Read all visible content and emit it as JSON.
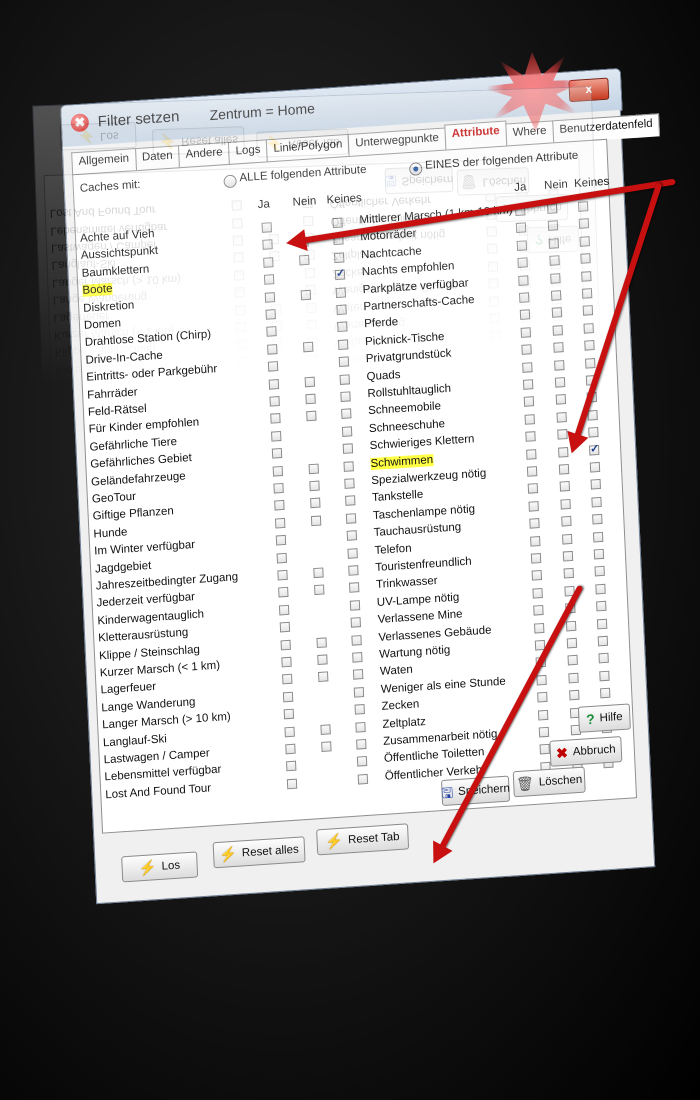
{
  "window": {
    "title": "Filter setzen",
    "subtitle": "Zentrum = Home",
    "close_label": "x"
  },
  "tabs": [
    {
      "label": "Allgemein"
    },
    {
      "label": "Daten"
    },
    {
      "label": "Andere"
    },
    {
      "label": "Logs"
    },
    {
      "label": "Linie/Polygon"
    },
    {
      "label": "Unterwegpunkte"
    },
    {
      "label": "Attribute",
      "active": true
    },
    {
      "label": "Where"
    },
    {
      "label": "Benutzerdatenfeld"
    }
  ],
  "caches_mit": {
    "label": "Caches mit:",
    "option_all": "ALLE folgenden Attribute",
    "option_any": "EINES der folgenden Attribute",
    "selected": "any"
  },
  "column_headers": {
    "ja": "Ja",
    "nein": "Nein",
    "keines": "Keines"
  },
  "left_attributes": [
    {
      "label": "Achte auf Vieh",
      "ja": false,
      "nein": null,
      "keines": false
    },
    {
      "label": "Aussichtspunkt",
      "ja": false,
      "nein": false,
      "keines": false
    },
    {
      "label": "Baumklettern",
      "ja": false,
      "nein": false,
      "keines": false
    },
    {
      "label": "Boote",
      "ja": false,
      "nein": null,
      "keines": true,
      "highlight": true
    },
    {
      "label": "Diskretion",
      "ja": false,
      "nein": false,
      "keines": false
    },
    {
      "label": "Domen",
      "ja": false,
      "nein": null,
      "keines": false
    },
    {
      "label": "Drahtlose Station (Chirp)",
      "ja": false,
      "nein": null,
      "keines": false
    },
    {
      "label": "Drive-In-Cache",
      "ja": false,
      "nein": false,
      "keines": false
    },
    {
      "label": "Eintritts- oder Parkgebühr",
      "ja": false,
      "nein": null,
      "keines": false
    },
    {
      "label": "Fahrräder",
      "ja": false,
      "nein": false,
      "keines": false
    },
    {
      "label": "Feld-Rätsel",
      "ja": false,
      "nein": false,
      "keines": false
    },
    {
      "label": "Für Kinder empfohlen",
      "ja": false,
      "nein": false,
      "keines": false
    },
    {
      "label": "Gefährliche Tiere",
      "ja": false,
      "nein": null,
      "keines": false
    },
    {
      "label": "Gefährliches Gebiet",
      "ja": false,
      "nein": null,
      "keines": false
    },
    {
      "label": "Geländefahrzeuge",
      "ja": false,
      "nein": false,
      "keines": false
    },
    {
      "label": "GeoTour",
      "ja": false,
      "nein": false,
      "keines": false
    },
    {
      "label": "Giftige Pflanzen",
      "ja": false,
      "nein": false,
      "keines": false
    },
    {
      "label": "Hunde",
      "ja": false,
      "nein": false,
      "keines": false
    },
    {
      "label": "Im Winter verfügbar",
      "ja": false,
      "nein": null,
      "keines": false
    },
    {
      "label": "Jagdgebiet",
      "ja": false,
      "nein": null,
      "keines": false
    },
    {
      "label": "Jahreszeitbedingter Zugang",
      "ja": false,
      "nein": false,
      "keines": false
    },
    {
      "label": "Jederzeit verfügbar",
      "ja": false,
      "nein": false,
      "keines": false
    },
    {
      "label": "Kinderwagentauglich",
      "ja": false,
      "nein": null,
      "keines": false
    },
    {
      "label": "Kletterausrüstung",
      "ja": false,
      "nein": null,
      "keines": false
    },
    {
      "label": "Klippe / Steinschlag",
      "ja": false,
      "nein": false,
      "keines": false
    },
    {
      "label": "Kurzer Marsch (< 1 km)",
      "ja": false,
      "nein": false,
      "keines": false
    },
    {
      "label": "Lagerfeuer",
      "ja": false,
      "nein": false,
      "keines": false
    },
    {
      "label": "Lange Wanderung",
      "ja": false,
      "nein": null,
      "keines": false
    },
    {
      "label": "Langer Marsch (> 10 km)",
      "ja": false,
      "nein": null,
      "keines": false
    },
    {
      "label": "Langlauf-Ski",
      "ja": false,
      "nein": false,
      "keines": false
    },
    {
      "label": "Lastwagen / Camper",
      "ja": false,
      "nein": false,
      "keines": false
    },
    {
      "label": "Lebensmittel verfügbar",
      "ja": false,
      "nein": null,
      "keines": false
    },
    {
      "label": "Lost And Found Tour",
      "ja": false,
      "nein": null,
      "keines": false
    }
  ],
  "right_attributes": [
    {
      "label": "Mittlerer Marsch (1 km-10 km)",
      "ja": false,
      "nein": false,
      "keines": false
    },
    {
      "label": "Motorräder",
      "ja": false,
      "nein": false,
      "keines": false
    },
    {
      "label": "Nachtcache",
      "ja": false,
      "nein": false,
      "keines": false
    },
    {
      "label": "Nachts empfohlen",
      "ja": false,
      "nein": false,
      "keines": false
    },
    {
      "label": "Parkplätze verfügbar",
      "ja": false,
      "nein": false,
      "keines": false
    },
    {
      "label": "Partnerschafts-Cache",
      "ja": false,
      "nein": false,
      "keines": false
    },
    {
      "label": "Pferde",
      "ja": false,
      "nein": false,
      "keines": false
    },
    {
      "label": "Picknick-Tische",
      "ja": false,
      "nein": false,
      "keines": false
    },
    {
      "label": "Privatgrundstück",
      "ja": false,
      "nein": false,
      "keines": false
    },
    {
      "label": "Quads",
      "ja": false,
      "nein": false,
      "keines": false
    },
    {
      "label": "Rollstuhltauglich",
      "ja": false,
      "nein": false,
      "keines": false
    },
    {
      "label": "Schneemobile",
      "ja": false,
      "nein": false,
      "keines": false
    },
    {
      "label": "Schneeschuhe",
      "ja": false,
      "nein": false,
      "keines": false
    },
    {
      "label": "Schwieriges Klettern",
      "ja": false,
      "nein": false,
      "keines": false
    },
    {
      "label": "Schwimmen",
      "ja": false,
      "nein": false,
      "keines": true,
      "highlight": true
    },
    {
      "label": "Spezialwerkzeug nötig",
      "ja": false,
      "nein": false,
      "keines": false
    },
    {
      "label": "Tankstelle",
      "ja": false,
      "nein": false,
      "keines": false
    },
    {
      "label": "Taschenlampe nötig",
      "ja": false,
      "nein": false,
      "keines": false
    },
    {
      "label": "Tauchausrüstung",
      "ja": false,
      "nein": false,
      "keines": false
    },
    {
      "label": "Telefon",
      "ja": false,
      "nein": false,
      "keines": false
    },
    {
      "label": "Touristenfreundlich",
      "ja": false,
      "nein": false,
      "keines": false
    },
    {
      "label": "Trinkwasser",
      "ja": false,
      "nein": false,
      "keines": false
    },
    {
      "label": "UV-Lampe nötig",
      "ja": false,
      "nein": false,
      "keines": false
    },
    {
      "label": "Verlassene Mine",
      "ja": false,
      "nein": false,
      "keines": false
    },
    {
      "label": "Verlassenes Gebäude",
      "ja": false,
      "nein": false,
      "keines": false
    },
    {
      "label": "Wartung nötig",
      "ja": false,
      "nein": false,
      "keines": false
    },
    {
      "label": "Waten",
      "ja": false,
      "nein": false,
      "keines": false
    },
    {
      "label": "Weniger als eine Stunde",
      "ja": false,
      "nein": false,
      "keines": false
    },
    {
      "label": "Zecken",
      "ja": false,
      "nein": false,
      "keines": false
    },
    {
      "label": "Zeltplatz",
      "ja": false,
      "nein": false,
      "keines": false
    },
    {
      "label": "Zusammenarbeit nötig",
      "ja": false,
      "nein": false,
      "keines": false
    },
    {
      "label": "Öffentliche Toiletten",
      "ja": false,
      "nein": false,
      "keines": false
    },
    {
      "label": "Öffentlicher Verkehr",
      "ja": false,
      "nein": false,
      "keines": false
    }
  ],
  "buttons": {
    "speichern": "Speichern",
    "loeschen": "Löschen",
    "abbruch": "Abbruch",
    "hilfe": "Hilfe",
    "los": "Los",
    "reset_alles": "Reset alles",
    "reset_tab": "Reset Tab"
  },
  "colors": {
    "active_tab": "#c00000",
    "highlight": "#ffff44",
    "arrow": "#c81010"
  }
}
